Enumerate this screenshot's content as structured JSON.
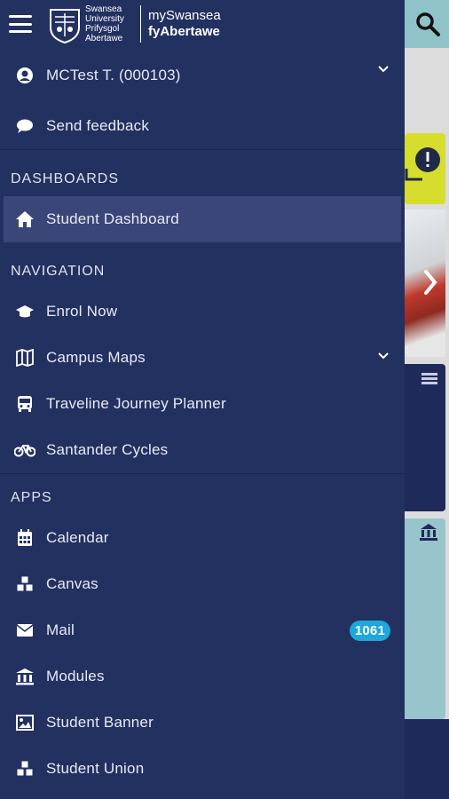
{
  "app": {
    "brand_line1": "mySwansea",
    "brand_line2": "fyAbertawe",
    "logo_text": "Swansea University Prifysgol Abertawe"
  },
  "user": {
    "name": "MCTest T. (000103)"
  },
  "feedback": {
    "label": "Send feedback"
  },
  "sections": {
    "dashboards": {
      "title": "DASHBOARDS",
      "items": [
        {
          "label": "Student Dashboard",
          "icon": "home-icon"
        }
      ]
    },
    "navigation": {
      "title": "NAVIGATION",
      "items": [
        {
          "label": "Enrol Now",
          "icon": "graduation-cap-icon"
        },
        {
          "label": "Campus Maps",
          "icon": "map-icon"
        },
        {
          "label": "Traveline Journey Planner",
          "icon": "bus-icon"
        },
        {
          "label": "Santander Cycles",
          "icon": "bicycle-icon"
        }
      ]
    },
    "apps": {
      "title": "APPS",
      "items": [
        {
          "label": "Calendar",
          "icon": "calendar-icon"
        },
        {
          "label": "Canvas",
          "icon": "cubes-icon"
        },
        {
          "label": "Mail",
          "icon": "envelope-icon",
          "badge": "1061"
        },
        {
          "label": "Modules",
          "icon": "institution-icon"
        },
        {
          "label": "Student Banner",
          "icon": "image-icon"
        },
        {
          "label": "Student Union",
          "icon": "cubes-icon"
        }
      ]
    }
  },
  "colors": {
    "drawer_bg": "#233161",
    "active_bg": "#3a4677",
    "badge_bg": "#1ea7d8"
  }
}
